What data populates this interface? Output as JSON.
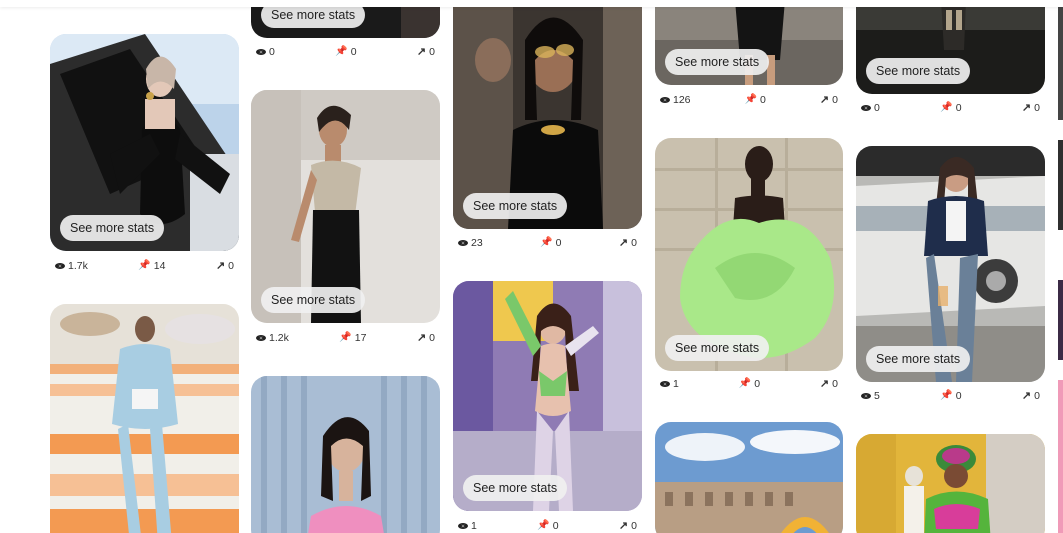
{
  "colors": {
    "page_bg": "#ffffff",
    "button_bg": "#efefef",
    "text": "#111111"
  },
  "icons": {
    "views": "eye-icon",
    "saves": "pin-icon",
    "outbound": "outbound-arrow-icon"
  },
  "button_label": "See more stats",
  "pins": [
    {
      "id": "pin-01",
      "views": "1.7k",
      "saves": "14",
      "outbound": "0",
      "image": "woman in black strapless gown leaning out of car window"
    },
    {
      "id": "pin-02",
      "views": "0",
      "saves": "0",
      "outbound": "0",
      "image": "dark fashion image partially cropped"
    },
    {
      "id": "pin-03",
      "views": "1.2k",
      "saves": "17",
      "outbound": "0",
      "image": "model in metallic corset top and black skirt"
    },
    {
      "id": "pin-04",
      "views": "23",
      "saves": "0",
      "outbound": "0",
      "image": "woman with gold face jewelry and black dress"
    },
    {
      "id": "pin-05",
      "views": "1",
      "saves": "0",
      "outbound": "0",
      "image": "woman in mesh lingerie on purple background"
    },
    {
      "id": "pin-06",
      "views": "126",
      "saves": "0",
      "outbound": "0",
      "image": "model legs in black dress"
    },
    {
      "id": "pin-07",
      "views": "1",
      "saves": "0",
      "outbound": "0",
      "image": "model in lime green ruffled gown"
    },
    {
      "id": "pin-08",
      "views": "0",
      "saves": "0",
      "outbound": "0",
      "image": "runway show dark scene"
    },
    {
      "id": "pin-09",
      "views": "5",
      "saves": "0",
      "outbound": "0",
      "image": "woman in navy varsity jacket and embellished jeans"
    },
    {
      "id": "pin-10",
      "views": "",
      "saves": "",
      "outbound": "",
      "image": "runway model in blue cutout outfit"
    },
    {
      "id": "pin-11",
      "views": "",
      "saves": "",
      "outbound": "",
      "image": "woman with bangs in pink halter top"
    },
    {
      "id": "pin-12",
      "views": "",
      "saves": "",
      "outbound": "",
      "image": "Louvre courtyard with blue sky"
    },
    {
      "id": "pin-13",
      "views": "",
      "saves": "",
      "outbound": "",
      "image": "man in green and pink knit outfit"
    }
  ]
}
